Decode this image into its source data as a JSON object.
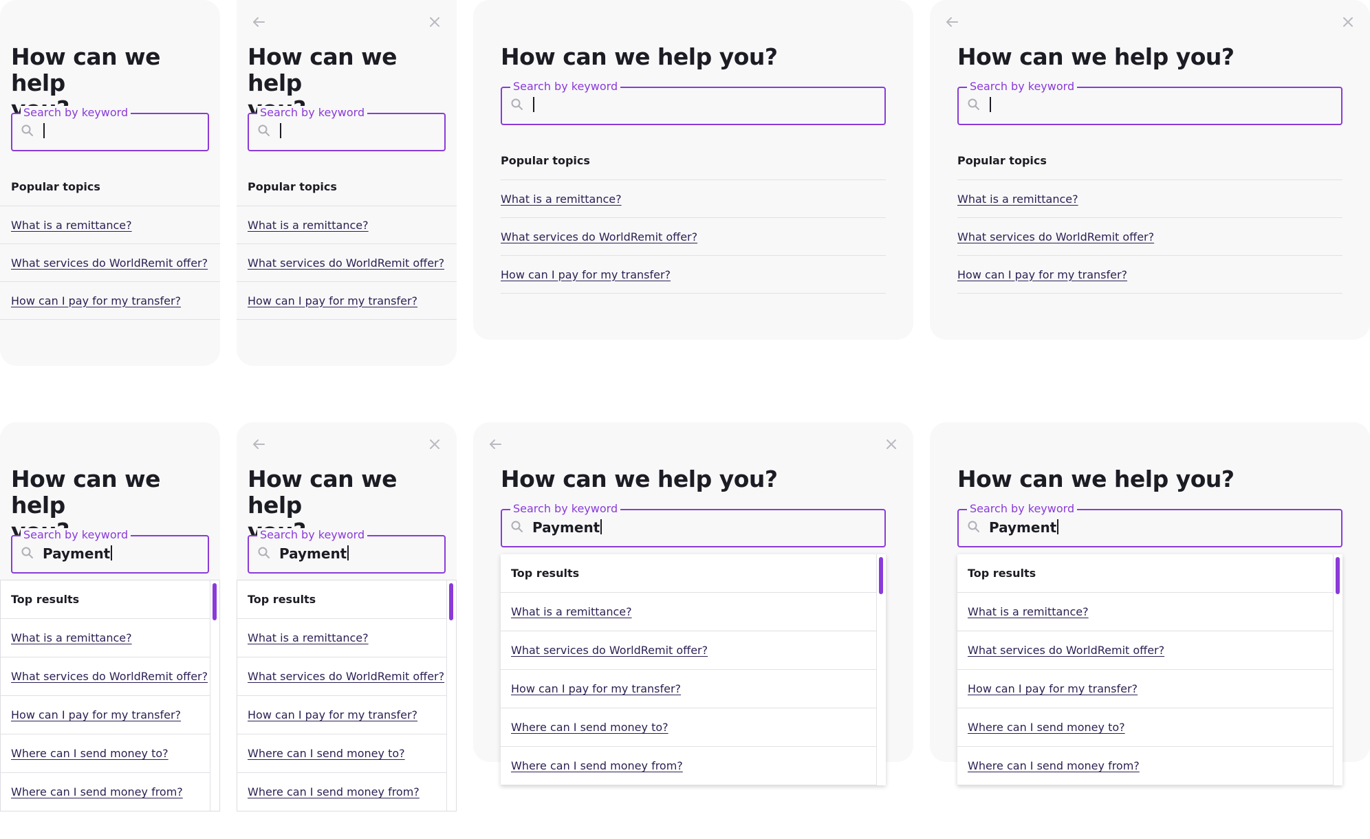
{
  "help": {
    "title": "How can we help you?",
    "title_line1": "How can we help",
    "title_line2": "you?",
    "search_label": "Search by keyword",
    "search_value_empty": "",
    "search_value_filled": "Payment",
    "popular_heading": "Popular topics",
    "results_heading": "Top results"
  },
  "popular_topics": [
    "What is a remittance?",
    "What services do WorldRemit offer?",
    "How can I pay for my transfer?"
  ],
  "top_results": [
    "What is a remittance?",
    "What services do WorldRemit offer?",
    "How can I pay for my transfer?",
    "Where can I send money to?",
    "Where can I send money from?"
  ],
  "icons": {
    "back": "arrow-left-icon",
    "close": "close-icon",
    "search": "search-icon"
  },
  "colors": {
    "accent": "#8a3ad8",
    "panel": "#f8f8f9",
    "text": "#1c1c24",
    "link": "#2b1f52",
    "divider": "#e1e1e6",
    "icon_muted": "#b9b9c0"
  }
}
